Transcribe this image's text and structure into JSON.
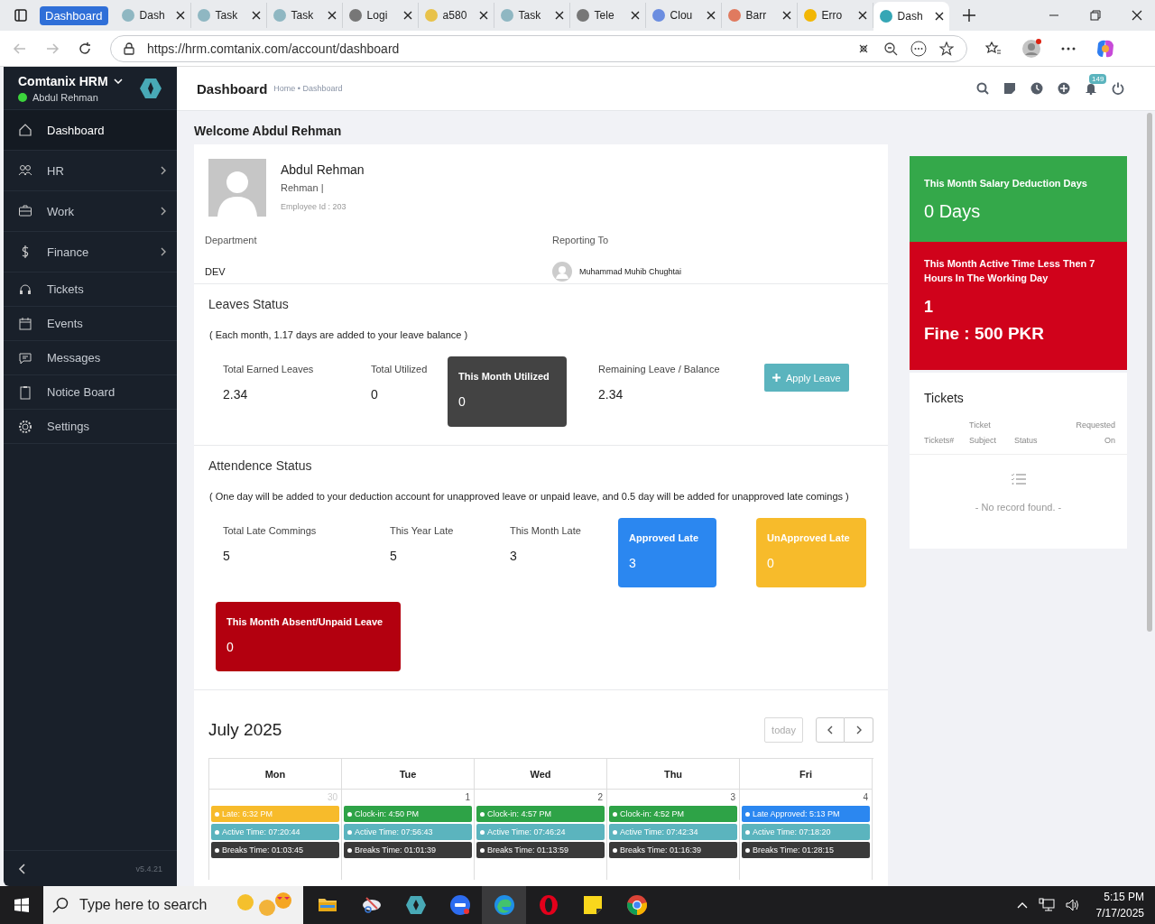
{
  "browser": {
    "tab_group": "Dashboard",
    "tabs": [
      {
        "label": "Dash",
        "selected": false
      },
      {
        "label": "Task",
        "selected": false
      },
      {
        "label": "Task",
        "selected": false
      },
      {
        "label": "Logi",
        "selected": false
      },
      {
        "label": "a580",
        "selected": false
      },
      {
        "label": "Task",
        "selected": false
      },
      {
        "label": "Tele",
        "selected": false
      },
      {
        "label": "Clou",
        "selected": false
      },
      {
        "label": "Barr",
        "selected": false
      },
      {
        "label": "Erro",
        "selected": false
      },
      {
        "label": "Dash",
        "selected": true
      }
    ],
    "url": "https://hrm.comtanix.com/account/dashboard"
  },
  "sidebar": {
    "brand": "Comtanix HRM",
    "user": "Abdul Rehman",
    "online": true,
    "items": [
      {
        "label": "Dashboard",
        "selected": true,
        "submenu": false
      },
      {
        "label": "HR",
        "selected": false,
        "submenu": true
      },
      {
        "label": "Work",
        "selected": false,
        "submenu": true
      },
      {
        "label": "Finance",
        "selected": false,
        "submenu": true
      },
      {
        "label": "Tickets",
        "selected": false,
        "submenu": false
      },
      {
        "label": "Events",
        "selected": false,
        "submenu": false
      },
      {
        "label": "Messages",
        "selected": false,
        "submenu": false
      },
      {
        "label": "Notice Board",
        "selected": false,
        "submenu": false
      },
      {
        "label": "Settings",
        "selected": false,
        "submenu": false
      }
    ],
    "version": "v5.4.21"
  },
  "header": {
    "title": "Dashboard",
    "breadcrumb": "Home • Dashboard",
    "notification_count": "149"
  },
  "welcome": "Welcome Abdul Rehman",
  "profile": {
    "name": "Abdul Rehman",
    "subtitle": "Rehman |",
    "employee_id": "Employee Id : 203",
    "department_label": "Department",
    "department": "DEV",
    "reporting_label": "Reporting To",
    "reporting_to": "Muhammad Muhib Chughtai"
  },
  "leaves": {
    "title": "Leaves Status",
    "note": "( Each month, 1.17 days are added to your leave balance )",
    "stats": [
      {
        "kind": "plain",
        "label": "Total Earned Leaves",
        "value": "2.34"
      },
      {
        "kind": "plain",
        "label": "Total Utilized",
        "value": "0"
      },
      {
        "kind": "tile",
        "color": "#434343",
        "label": "This Month Utilized",
        "value": "0"
      },
      {
        "kind": "plain",
        "label": "Remaining Leave / Balance",
        "value": "2.34"
      }
    ],
    "button": "Apply Leave"
  },
  "attendance": {
    "title": "Attendence Status",
    "note": "( One day will be added to your deduction account for unapproved leave or unpaid leave, and 0.5 day will be added for unapproved late comings )",
    "stats": [
      {
        "kind": "plain",
        "label": "Total Late Commings",
        "value": "5"
      },
      {
        "kind": "plain",
        "label": "This Year Late",
        "value": "5"
      },
      {
        "kind": "plain",
        "label": "This Month Late",
        "value": "3"
      },
      {
        "kind": "tile",
        "color": "#2b87f0",
        "label": "Approved Late",
        "value": "3"
      },
      {
        "kind": "tile",
        "color": "#f7bb2b",
        "label": "UnApproved Late",
        "value": "0"
      },
      {
        "kind": "tile",
        "color": "#b3000f",
        "label": "This Month Absent/Unpaid Leave",
        "value": "0"
      }
    ]
  },
  "calendar": {
    "title": "July 2025",
    "today": "today",
    "weekdays": [
      "Mon",
      "Tue",
      "Wed",
      "Thu",
      "Fri"
    ],
    "cells": [
      {
        "day": "30",
        "other_month": true,
        "events": [
          {
            "text": "Late: 6:32 PM",
            "color": "#f7bb2b"
          },
          {
            "text": "Active Time: 07:20:44",
            "color": "#5bb4be"
          },
          {
            "text": "Breaks Time: 01:03:45",
            "color": "#3a3a3a"
          }
        ]
      },
      {
        "day": "1",
        "other_month": false,
        "events": [
          {
            "text": "Clock-in: 4:50 PM",
            "color": "#2ea347"
          },
          {
            "text": "Active Time: 07:56:43",
            "color": "#5bb4be"
          },
          {
            "text": "Breaks Time: 01:01:39",
            "color": "#3a3a3a"
          }
        ]
      },
      {
        "day": "2",
        "other_month": false,
        "events": [
          {
            "text": "Clock-in: 4:57 PM",
            "color": "#2ea347"
          },
          {
            "text": "Active Time: 07:46:24",
            "color": "#5bb4be"
          },
          {
            "text": "Breaks Time: 01:13:59",
            "color": "#3a3a3a"
          }
        ]
      },
      {
        "day": "3",
        "other_month": false,
        "events": [
          {
            "text": "Clock-in: 4:52 PM",
            "color": "#2ea347"
          },
          {
            "text": "Active Time: 07:42:34",
            "color": "#5bb4be"
          },
          {
            "text": "Breaks Time: 01:16:39",
            "color": "#3a3a3a"
          }
        ]
      },
      {
        "day": "4",
        "other_month": false,
        "events": [
          {
            "text": "Late Approved: 5:13 PM",
            "color": "#2b87f0"
          },
          {
            "text": "Active Time: 07:18:20",
            "color": "#5bb4be"
          },
          {
            "text": "Breaks Time: 01:28:15",
            "color": "#3a3a3a"
          }
        ]
      }
    ]
  },
  "salary_card": {
    "title": "This Month Salary Deduction Days",
    "value": "0 Days"
  },
  "fine_card": {
    "title": "This Month Active Time Less Then 7 Hours In The Working Day",
    "count": "1",
    "fine": "Fine : 500 PKR"
  },
  "tickets": {
    "title": "Tickets",
    "columns": [
      "Tickets#",
      "Ticket Subject",
      "Status",
      "Requested On"
    ],
    "empty": "- No record found. -"
  },
  "taskbar": {
    "search_placeholder": "Type here to search",
    "time": "5:15 PM",
    "date": "7/17/2025"
  }
}
